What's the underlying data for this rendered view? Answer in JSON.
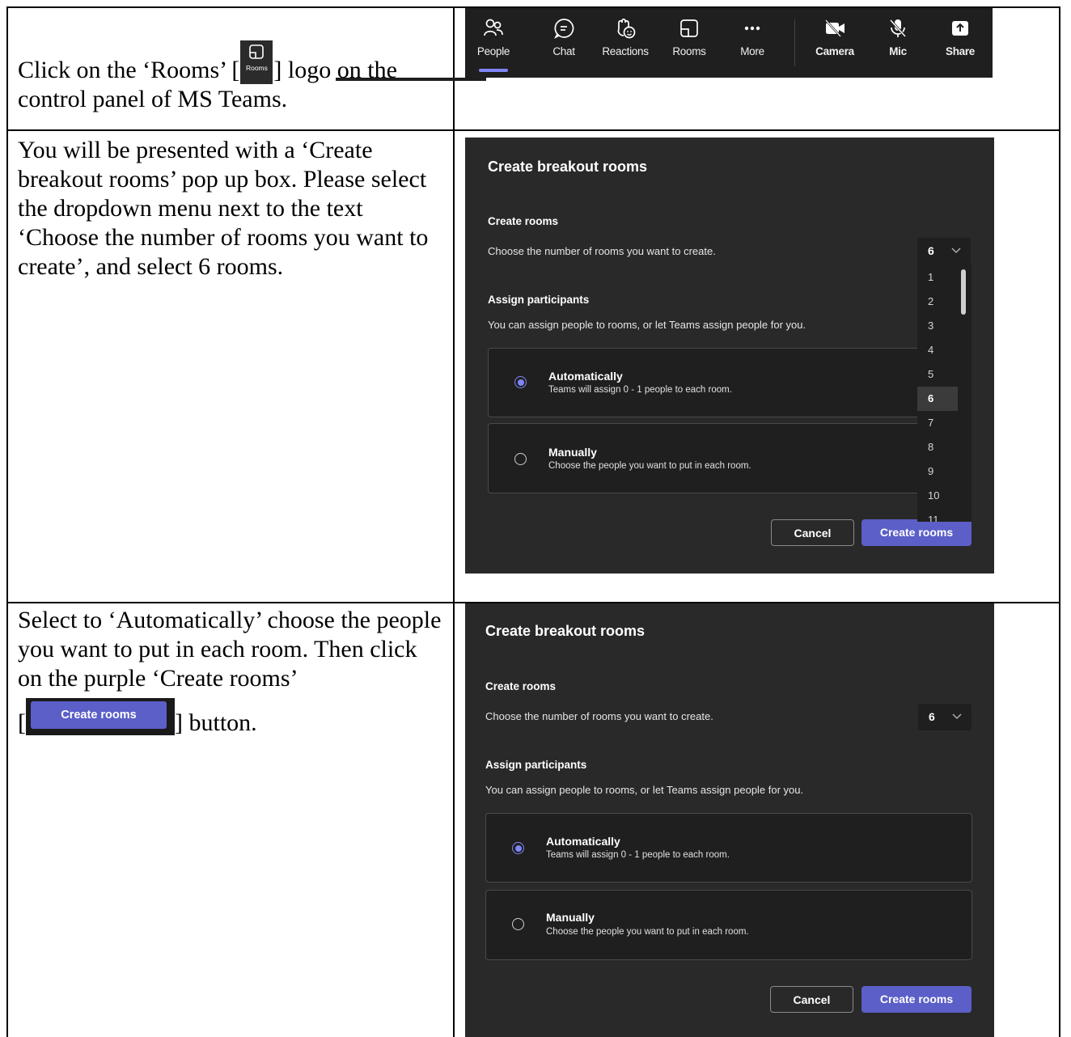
{
  "rows": [
    {
      "text_before": "Click on the ‘Rooms’ [",
      "inline_label": "Rooms",
      "text_after": "] logo on the control panel of MS Teams."
    },
    {
      "text": "You will be presented with a ‘Create breakout rooms’ pop up box. Please select the dropdown menu next to the text ‘Choose the number of rooms you want to create’, and select 6 rooms."
    },
    {
      "text_line1": "Select to ‘Automatically’ choose the people you want to put in each room. Then click on the purple ‘Create rooms’",
      "inline_label": "Create rooms",
      "text_after": "] button.",
      "bracket_open": "["
    }
  ],
  "toolbar": {
    "items": [
      {
        "label": "People",
        "icon": "people-icon"
      },
      {
        "label": "Chat",
        "icon": "chat-icon"
      },
      {
        "label": "Reactions",
        "icon": "reactions-icon"
      },
      {
        "label": "Rooms",
        "icon": "rooms-icon"
      },
      {
        "label": "More",
        "icon": "more-icon"
      },
      {
        "label": "Camera",
        "icon": "camera-off-icon"
      },
      {
        "label": "Mic",
        "icon": "mic-off-icon"
      },
      {
        "label": "Share",
        "icon": "share-icon"
      }
    ],
    "active": "People"
  },
  "dialog": {
    "title": "Create breakout rooms",
    "create_rooms_heading": "Create rooms",
    "choose_text": "Choose the number of rooms you want to create.",
    "selected_count": "6",
    "assign_heading": "Assign participants",
    "assign_text": "You can assign people to rooms, or let Teams assign people for you.",
    "auto_title": "Automatically",
    "auto_desc": "Teams will assign 0 - 1 people to each room.",
    "manual_title": "Manually",
    "manual_desc": "Choose the people you want to put in each room.",
    "cancel_label": "Cancel",
    "create_label": "Create rooms",
    "dropdown_options": [
      "1",
      "2",
      "3",
      "4",
      "5",
      "6",
      "7",
      "8",
      "9",
      "10",
      "11"
    ],
    "accent_color": "#5b5fc7"
  }
}
